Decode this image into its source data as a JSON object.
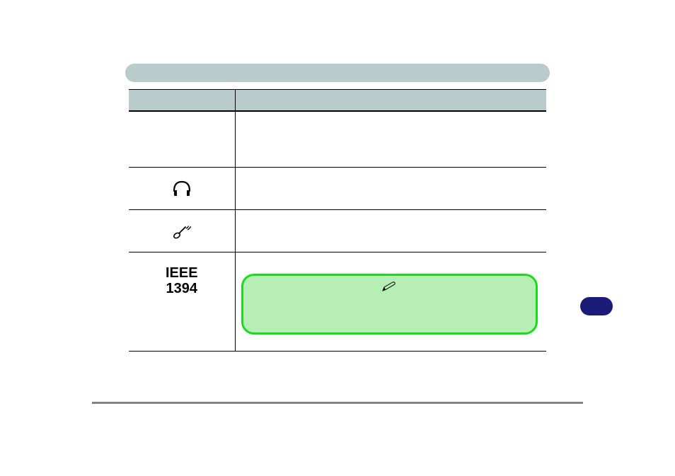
{
  "icons": {
    "headphone": "headphone-icon",
    "microphone": "microphone-icon",
    "pencil": "pencil-icon"
  },
  "table": {
    "rows": {
      "ieee1394": {
        "label_line1": "IEEE",
        "label_line2": "1394"
      }
    }
  }
}
